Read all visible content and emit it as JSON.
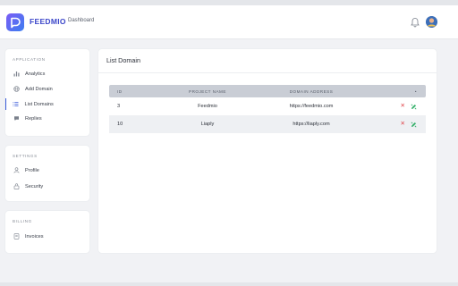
{
  "header": {
    "brand": "FEEDMIO",
    "breadcrumb": "Dashboard"
  },
  "sidebar": {
    "application": {
      "title": "APPLICATION",
      "items": [
        {
          "label": "Analytics",
          "icon": "bar-chart-icon"
        },
        {
          "label": "Add Domain",
          "icon": "globe-icon"
        },
        {
          "label": "List Domains",
          "icon": "list-icon",
          "active": true
        },
        {
          "label": "Replies",
          "icon": "chat-icon"
        }
      ]
    },
    "settings": {
      "title": "SETTINGS",
      "items": [
        {
          "label": "Profile",
          "icon": "user-icon"
        },
        {
          "label": "Security",
          "icon": "lock-icon"
        }
      ]
    },
    "billing": {
      "title": "BILLING",
      "items": [
        {
          "label": "Invoices",
          "icon": "invoice-icon"
        }
      ]
    }
  },
  "main": {
    "title": "List Domain",
    "table": {
      "headers": [
        "ID",
        "PROJECT NAME",
        "DOMAIN ADDRESS",
        "•"
      ],
      "rows": [
        {
          "id": "3",
          "name": "Feedmio",
          "domain": "https://feedmio.com"
        },
        {
          "id": "10",
          "name": "Liaply",
          "domain": "https://liaply.com"
        }
      ]
    }
  },
  "colors": {
    "brand": "#3a45c9",
    "accent": "#3a5bd9",
    "delete": "#e0454a",
    "edit": "#2fae66",
    "header_row": "#c9cdd5"
  }
}
